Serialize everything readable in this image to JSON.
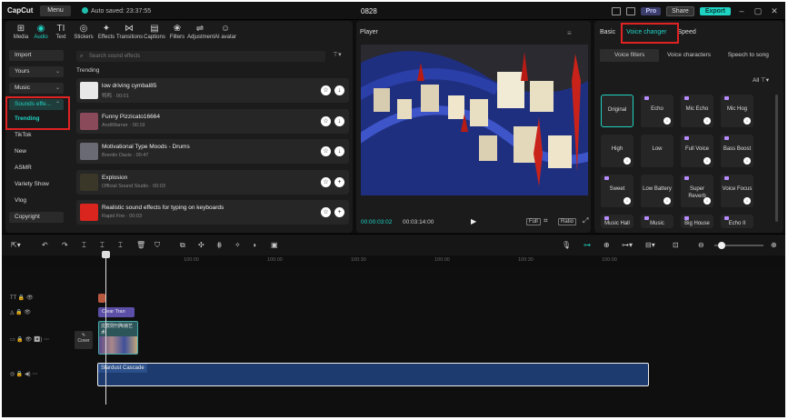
{
  "app": {
    "name": "CapCut",
    "menu": "Menu",
    "autosave": "Auto saved: 23:37:55",
    "project_title": "0828",
    "pro": "Pro",
    "share": "Share",
    "export": "Export"
  },
  "toolbar": [
    {
      "label": "Media",
      "icon": "media-icon"
    },
    {
      "label": "Audio",
      "icon": "audio-icon",
      "active": true
    },
    {
      "label": "Text",
      "icon": "text-icon"
    },
    {
      "label": "Stickers",
      "icon": "stickers-icon"
    },
    {
      "label": "Effects",
      "icon": "effects-icon"
    },
    {
      "label": "Transitions",
      "icon": "transitions-icon"
    },
    {
      "label": "Captions",
      "icon": "captions-icon"
    },
    {
      "label": "Filters",
      "icon": "filters-icon"
    },
    {
      "label": "Adjustment",
      "icon": "adjustment-icon"
    },
    {
      "label": "AI avatar",
      "icon": "ai-avatar-icon"
    }
  ],
  "sidenav": {
    "import": "Import",
    "yours": "Yours",
    "music": "Music",
    "sound_effects": "Sounds effe...",
    "sub_items": [
      "Trending",
      "TikTok",
      "New",
      "ASMR",
      "Variety Show",
      "Vlog"
    ],
    "copyright": "Copyright"
  },
  "search": {
    "placeholder": "Search sound effects"
  },
  "trending_label": "Trending",
  "sounds": [
    {
      "title": "low driving cymbal85",
      "sub": "鸭鸭 · 00:01",
      "thumb": "#e8e8e8",
      "action": "download"
    },
    {
      "title": "Funny Pizzicato16664",
      "sub": "AndiWarner · 00:19",
      "thumb": "#8a4a5a",
      "action": "download"
    },
    {
      "title": "Motivational Type Moods - Drums",
      "sub": "Brentin Davis · 00:47",
      "thumb": "#6a6a74",
      "action": "download"
    },
    {
      "title": "Explosion",
      "sub": "Official Sound Studio · 00:03",
      "thumb": "#3a3628",
      "action": "add"
    },
    {
      "title": "Realistic sound effects for typing on keyboards",
      "sub": "Rapid Fire · 00:03",
      "thumb": "#d9251d",
      "action": "add"
    }
  ],
  "player": {
    "title": "Player",
    "current": "00:00:03:02",
    "total": "00:03:14:00",
    "full": "Full",
    "ratio": "Ratio"
  },
  "right_panel": {
    "tabs": [
      "Basic",
      "Voice changer",
      "Speed"
    ],
    "active_tab": "Voice changer",
    "subtabs": [
      "Voice filters",
      "Voice characters",
      "Speech to song"
    ],
    "filter_all": "All",
    "voices": [
      {
        "name": "Original",
        "selected": true,
        "pro": false,
        "dl": false
      },
      {
        "name": "Echo",
        "pro": true,
        "dl": true
      },
      {
        "name": "Mic Echo",
        "pro": true,
        "dl": true
      },
      {
        "name": "Mic Hog",
        "pro": true,
        "dl": true
      },
      {
        "name": "High",
        "pro": false,
        "dl": true
      },
      {
        "name": "Low",
        "pro": false,
        "dl": false
      },
      {
        "name": "Full Voice",
        "pro": true,
        "dl": true
      },
      {
        "name": "Bass Boost",
        "pro": true,
        "dl": true
      },
      {
        "name": "Sweet",
        "pro": true,
        "dl": true
      },
      {
        "name": "Low Battery",
        "pro": false,
        "dl": true
      },
      {
        "name": "Super Reverb",
        "pro": true,
        "dl": true
      },
      {
        "name": "Voice Focus",
        "pro": true,
        "dl": true
      },
      {
        "name": "Music Hall",
        "pro": true,
        "dl": false
      },
      {
        "name": "Music Enhancer",
        "pro": true,
        "dl": false
      },
      {
        "name": "Big House",
        "pro": true,
        "dl": false
      },
      {
        "name": "Echo II",
        "pro": true,
        "dl": false
      }
    ]
  },
  "timeline": {
    "ruler": [
      "100:00",
      "100:00",
      "100:30",
      "100:00",
      "100:30",
      "100:00"
    ],
    "clips": {
      "effect": "Clear Tran",
      "video": "沈宸则刊陶嶺艺术",
      "cover": "Cover",
      "audio": "Stardust Cascade"
    }
  }
}
